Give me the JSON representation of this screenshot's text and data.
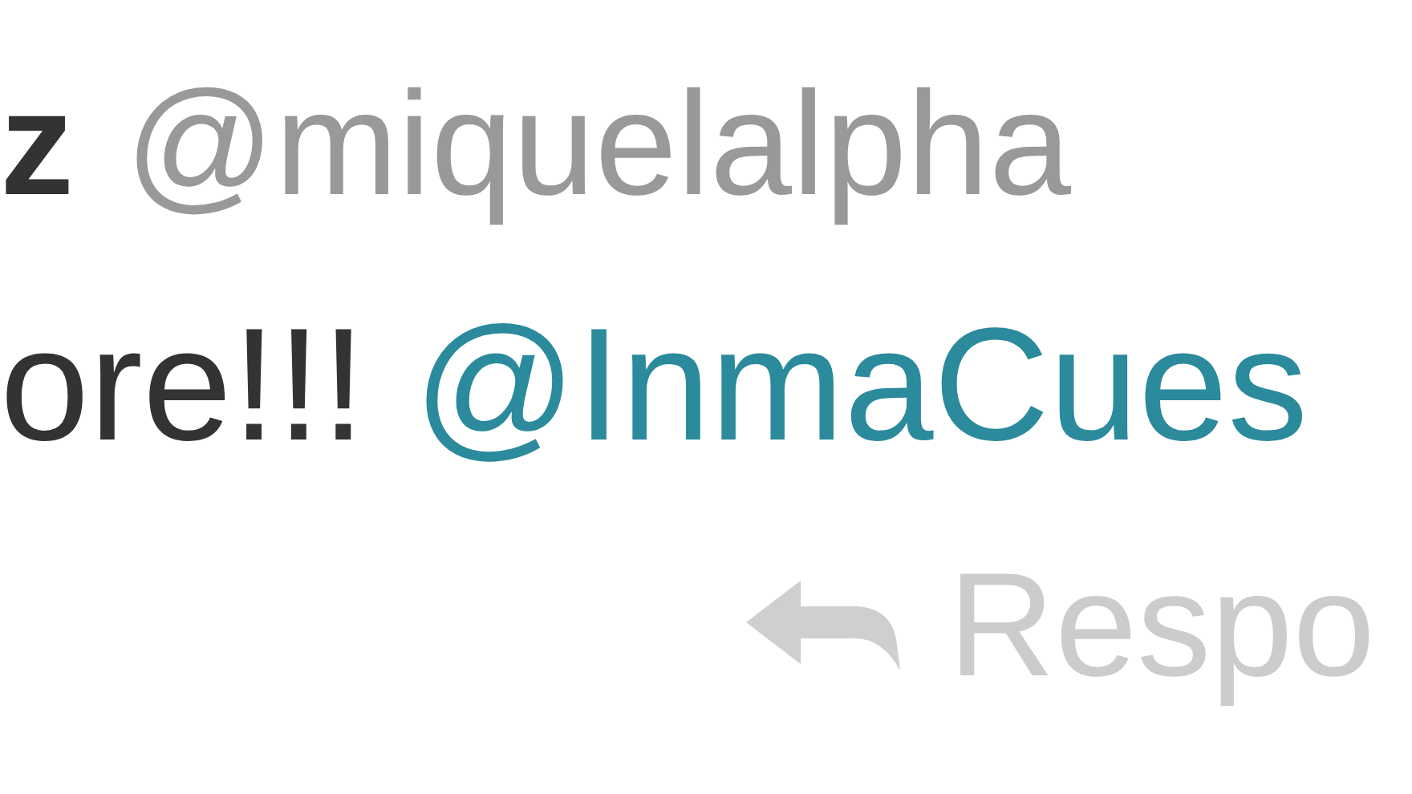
{
  "tweet": {
    "author_name": "z",
    "handle": "@miquelalpha",
    "text": "ore!!!",
    "mention": "@InmaCues",
    "actions": [
      {
        "kind": "reply",
        "label": "Respo"
      }
    ]
  }
}
